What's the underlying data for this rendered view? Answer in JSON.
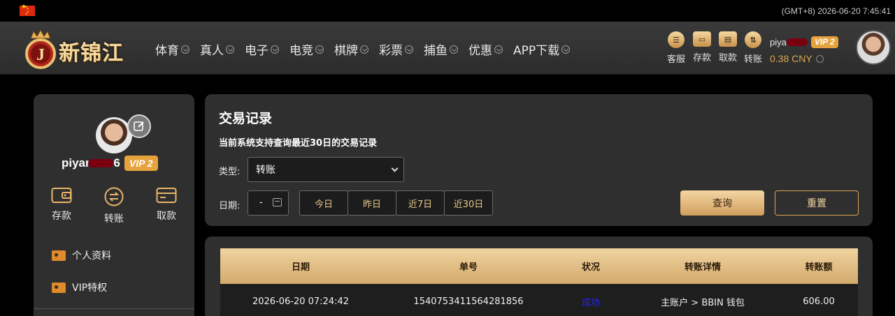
{
  "topbar": {
    "timezone_clock": "(GMT+8) 2026-06-20 7:45:41"
  },
  "brand": {
    "name": "新锦江",
    "badge_letter": "J"
  },
  "nav": [
    {
      "label": "体育"
    },
    {
      "label": "真人"
    },
    {
      "label": "电子"
    },
    {
      "label": "电竞"
    },
    {
      "label": "棋牌"
    },
    {
      "label": "彩票"
    },
    {
      "label": "捕鱼"
    },
    {
      "label": "优惠"
    },
    {
      "label": "APP下载"
    }
  ],
  "quick_actions": [
    {
      "label": "客服",
      "icon": "customer-service-icon"
    },
    {
      "label": "存款",
      "icon": "deposit-wallet-icon"
    },
    {
      "label": "取款",
      "icon": "withdraw-icon"
    },
    {
      "label": "转账",
      "icon": "transfer-icon"
    }
  ],
  "user": {
    "name_visible": "piya",
    "vip": "VIP 2",
    "balance": "0.38 CNY",
    "side_name_visible": "piyan",
    "side_name_tail": "6"
  },
  "sidebar": {
    "actions": [
      {
        "label": "存款",
        "icon": "wallet-icon"
      },
      {
        "label": "转账",
        "icon": "transfer-icon"
      },
      {
        "label": "取款",
        "icon": "card-icon"
      }
    ],
    "menu": [
      {
        "label": "个人资料"
      },
      {
        "label": "VIP特权"
      }
    ]
  },
  "filter": {
    "title": "交易记录",
    "subtitle": "当前系统支持查询最近30日的交易记录",
    "type_label": "类型:",
    "type_value": "转账",
    "date_label": "日期:",
    "date_value": "-",
    "quick_dates": [
      "今日",
      "昨日",
      "近7日",
      "近30日"
    ],
    "query_button": "查询",
    "reset_button": "重置"
  },
  "table": {
    "headers": [
      "日期",
      "单号",
      "状况",
      "转账详情",
      "转账额"
    ],
    "rows": [
      [
        "2026-06-20 07:24:42",
        "1540753411564281856",
        "成功",
        "主账户 > BBIN 钱包",
        "606.00"
      ]
    ]
  }
}
